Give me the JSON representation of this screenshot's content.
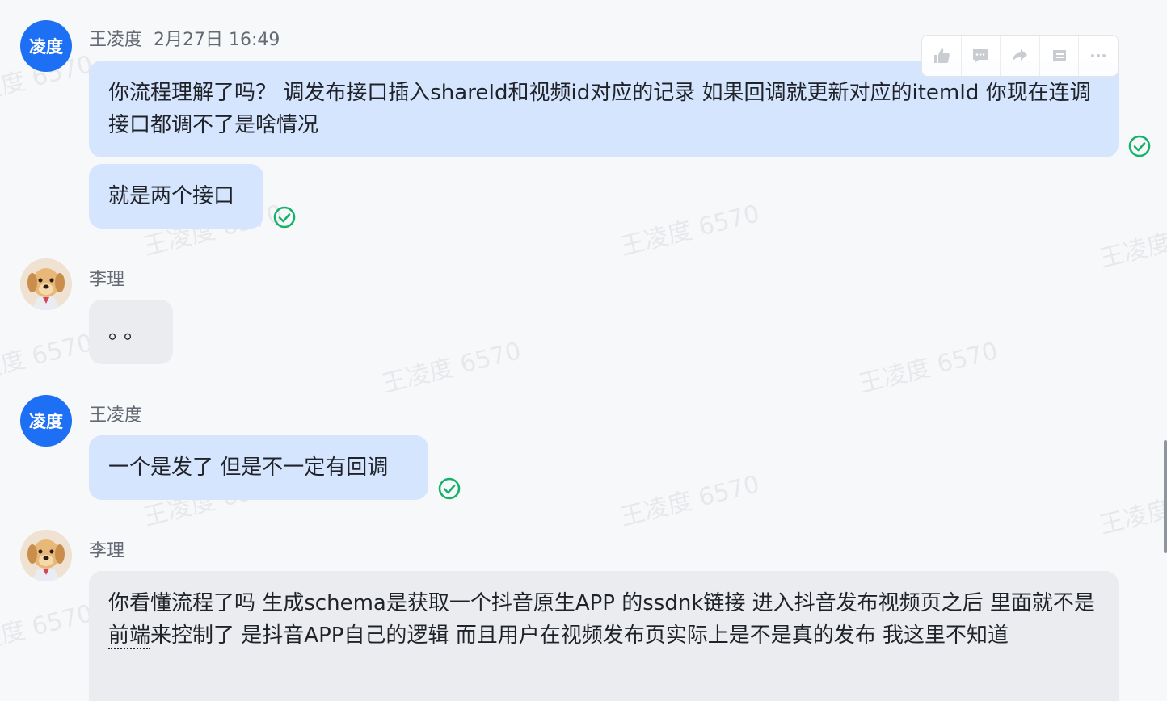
{
  "messages": [
    {
      "sender": "王凌度",
      "avatar_text": "凌度",
      "time": "2月27日 16:49",
      "bubbles": [
        "你流程理解了吗？ 调发布接口插入shareId和视频id对应的记录 如果回调就更新对应的itemId 你现在连调接口都调不了是啥情况",
        "就是两个接口"
      ]
    },
    {
      "sender": "李理",
      "bubbles": [
        "。。"
      ]
    },
    {
      "sender": "王凌度",
      "avatar_text": "凌度",
      "bubbles": [
        "一个是发了 但是不一定有回调"
      ]
    },
    {
      "sender": "李理",
      "bubbles": [
        {
          "before": "你看懂流程了吗  生成schema是获取一个抖音原生APP  的ssdnk链接   进入抖音发布视频页之后  里面就不是",
          "underlined": "前端",
          "after": "来控制了  是抖音APP自己的逻辑  而且用户在视频发布页实际上是不是真的发布 我这里不知道"
        }
      ]
    }
  ],
  "watermark_text": "王凌度 6570",
  "toolbar_icons": [
    "thumbs-up-icon",
    "comment-icon",
    "forward-icon",
    "quote-icon",
    "more-icon"
  ],
  "colors": {
    "my_bubble": "#d6e5fe",
    "their_bubble": "#ebecef",
    "avatar_blue": "#1d6ff3",
    "read_check": "#17b26a",
    "background": "#f7f8fa"
  }
}
